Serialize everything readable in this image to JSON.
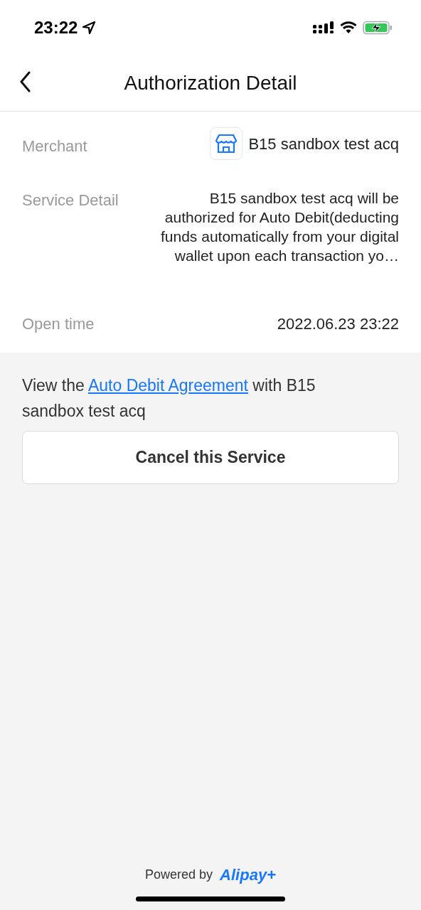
{
  "status_bar": {
    "time": "23:22"
  },
  "nav": {
    "title": "Authorization Detail"
  },
  "details": [
    {
      "kind": "merchant",
      "label": "Merchant",
      "value": "B15 sandbox test acq"
    },
    {
      "kind": "text",
      "label": "Service Detail",
      "value": "B15 sandbox test acq will be authorized for Auto Debit(deducting funds automatically from your digital wallet upon each transaction yo…"
    },
    {
      "kind": "plain",
      "label": "Open time",
      "value": "2022.06.23 23:22"
    }
  ],
  "agreement": {
    "before": "View the",
    "link": "Auto Debit Agreement",
    "after": "with B15 sandbox test acq"
  },
  "cancel_button": "Cancel this Service",
  "footer": {
    "powered_by": "Powered by",
    "brand": "Alipay+"
  }
}
